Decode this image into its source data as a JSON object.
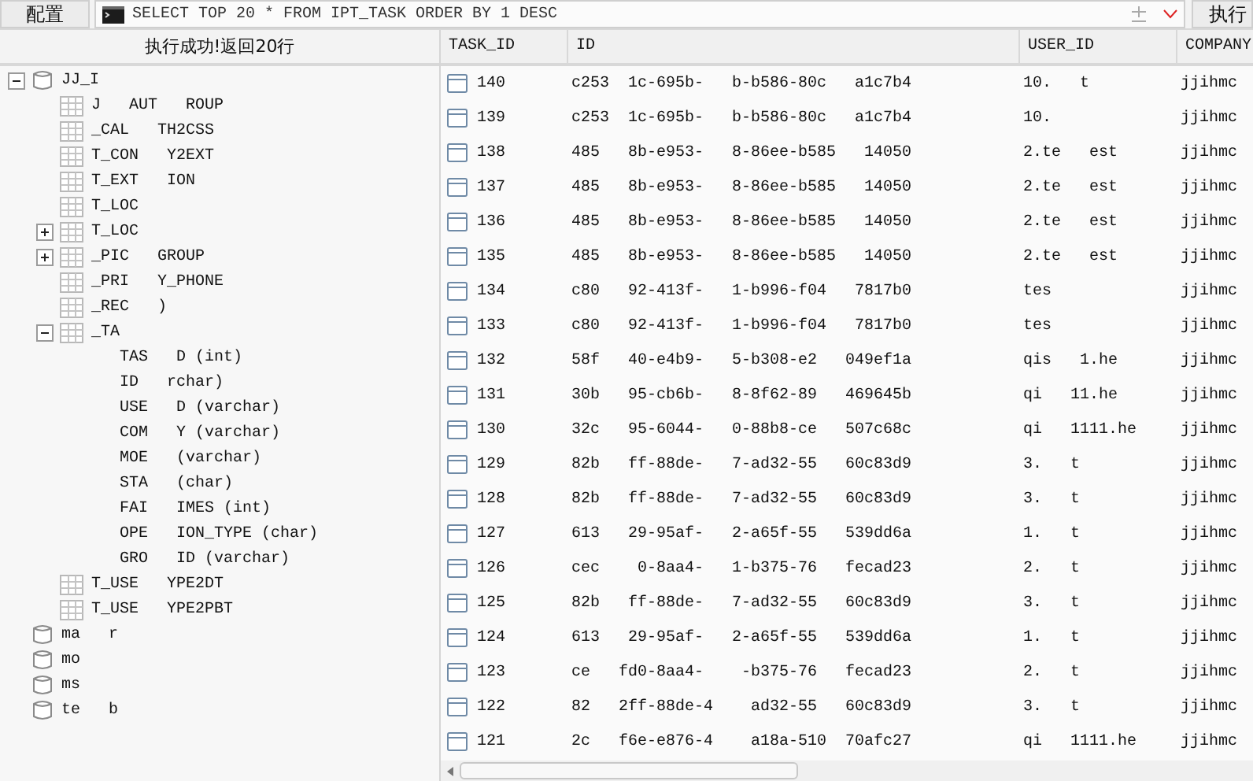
{
  "toolbar": {
    "config_button": "配置",
    "query": "SELECT TOP 20 * FROM IPT_TASK ORDER BY 1 DESC",
    "run_button": "执行"
  },
  "tree": {
    "status": "执行成功!返回20行",
    "nodes": [
      {
        "kind": "database",
        "label": "JJ_I",
        "expanded": true,
        "children": [
          {
            "kind": "table",
            "label": "J   AUT   ROUP"
          },
          {
            "kind": "table",
            "label": "_CAL   TH2CSS"
          },
          {
            "kind": "table",
            "label": "T_CON   Y2EXT"
          },
          {
            "kind": "table",
            "label": "T_EXT   ION"
          },
          {
            "kind": "table",
            "label": "T_LOC"
          },
          {
            "kind": "table",
            "label": "T_LOC",
            "expanded": false
          },
          {
            "kind": "table",
            "label": "_PIC   GROUP",
            "expanded": false
          },
          {
            "kind": "table",
            "label": "_PRI   Y_PHONE"
          },
          {
            "kind": "table",
            "label": "_REC   )"
          },
          {
            "kind": "table",
            "label": "_TA",
            "expanded": true,
            "children": [
              {
                "kind": "column",
                "label": "TAS   D (int)"
              },
              {
                "kind": "column",
                "label": "ID   rchar)"
              },
              {
                "kind": "column",
                "label": "USE   D (varchar)"
              },
              {
                "kind": "column",
                "label": "COM   Y (varchar)"
              },
              {
                "kind": "column",
                "label": "MOE   (varchar)"
              },
              {
                "kind": "column",
                "label": "STA   (char)"
              },
              {
                "kind": "column",
                "label": "FAI   IMES (int)"
              },
              {
                "kind": "column",
                "label": "OPE   ION_TYPE (char)"
              },
              {
                "kind": "column",
                "label": "GRO   ID (varchar)"
              }
            ]
          },
          {
            "kind": "table",
            "label": "T_USE   YPE2DT"
          },
          {
            "kind": "table",
            "label": "T_USE   YPE2PBT"
          }
        ]
      },
      {
        "kind": "database",
        "label": "ma   r"
      },
      {
        "kind": "database",
        "label": "mo"
      },
      {
        "kind": "database",
        "label": "ms"
      },
      {
        "kind": "database",
        "label": "te   b"
      }
    ]
  },
  "table": {
    "columns": [
      "TASK_ID",
      "ID",
      "USER_ID",
      "COMPANY"
    ],
    "rows": [
      {
        "task_id": "140",
        "id": "c253  1c-695b-   b-b586-80c   a1c7b4",
        "user_id": "10.   t",
        "company": "jjihmc"
      },
      {
        "task_id": "139",
        "id": "c253  1c-695b-   b-b586-80c   a1c7b4",
        "user_id": "10.",
        "company": "jjihmc"
      },
      {
        "task_id": "138",
        "id": "485   8b-e953-   8-86ee-b585   14050",
        "user_id": "2.te   est",
        "company": "jjihmc"
      },
      {
        "task_id": "137",
        "id": "485   8b-e953-   8-86ee-b585   14050",
        "user_id": "2.te   est",
        "company": "jjihmc"
      },
      {
        "task_id": "136",
        "id": "485   8b-e953-   8-86ee-b585   14050",
        "user_id": "2.te   est",
        "company": "jjihmc"
      },
      {
        "task_id": "135",
        "id": "485   8b-e953-   8-86ee-b585   14050",
        "user_id": "2.te   est",
        "company": "jjihmc"
      },
      {
        "task_id": "134",
        "id": "c80   92-413f-   1-b996-f04   7817b0",
        "user_id": "tes",
        "company": "jjihmc"
      },
      {
        "task_id": "133",
        "id": "c80   92-413f-   1-b996-f04   7817b0",
        "user_id": "tes",
        "company": "jjihmc"
      },
      {
        "task_id": "132",
        "id": "58f   40-e4b9-   5-b308-e2   049ef1a",
        "user_id": "qis   1.he",
        "company": "jjihmc"
      },
      {
        "task_id": "131",
        "id": "30b   95-cb6b-   8-8f62-89   469645b",
        "user_id": "qi   11.he",
        "company": "jjihmc"
      },
      {
        "task_id": "130",
        "id": "32c   95-6044-   0-88b8-ce   507c68c",
        "user_id": "qi   1111.he",
        "company": "jjihmc"
      },
      {
        "task_id": "129",
        "id": "82b   ff-88de-   7-ad32-55   60c83d9",
        "user_id": "3.   t",
        "company": "jjihmc"
      },
      {
        "task_id": "128",
        "id": "82b   ff-88de-   7-ad32-55   60c83d9",
        "user_id": "3.   t",
        "company": "jjihmc"
      },
      {
        "task_id": "127",
        "id": "613   29-95af-   2-a65f-55   539dd6a",
        "user_id": "1.   t",
        "company": "jjihmc"
      },
      {
        "task_id": "126",
        "id": "cec    0-8aa4-   1-b375-76   fecad23",
        "user_id": "2.   t",
        "company": "jjihmc"
      },
      {
        "task_id": "125",
        "id": "82b   ff-88de-   7-ad32-55   60c83d9",
        "user_id": "3.   t",
        "company": "jjihmc"
      },
      {
        "task_id": "124",
        "id": "613   29-95af-   2-a65f-55   539dd6a",
        "user_id": "1.   t",
        "company": "jjihmc"
      },
      {
        "task_id": "123",
        "id": "ce   fd0-8aa4-    -b375-76   fecad23",
        "user_id": "2.   t",
        "company": "jjihmc"
      },
      {
        "task_id": "122",
        "id": "82   2ff-88de-4    ad32-55   60c83d9",
        "user_id": "3.   t",
        "company": "jjihmc"
      },
      {
        "task_id": "121",
        "id": "2c   f6e-e876-4    a18a-510  70afc27",
        "user_id": "qi   1111.he",
        "company": "jjihmc"
      }
    ]
  }
}
